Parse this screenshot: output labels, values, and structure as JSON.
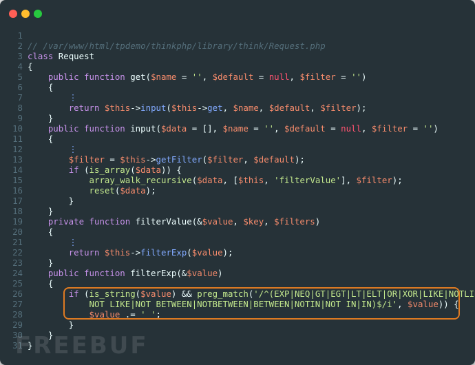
{
  "editor": {
    "file_comment": "// /var/www/html/tpdemo/thinkphp/library/think/Request.php",
    "watermark": "FREEBUF",
    "lines": [
      {
        "n": "1",
        "tokens": []
      },
      {
        "n": "2",
        "tokens": [
          {
            "c": "comment",
            "t": "// /var/www/html/tpdemo/thinkphp/library/think/Request.php"
          }
        ]
      },
      {
        "n": "3",
        "tokens": [
          {
            "c": "kw",
            "t": "class"
          },
          {
            "c": "plain",
            "t": " Request"
          }
        ]
      },
      {
        "n": "4",
        "tokens": [
          {
            "c": "plain",
            "t": "{"
          }
        ]
      },
      {
        "n": "5",
        "tokens": [
          {
            "c": "plain",
            "t": "    "
          },
          {
            "c": "kw",
            "t": "public function"
          },
          {
            "c": "plain",
            "t": " get("
          },
          {
            "c": "var",
            "t": "$name"
          },
          {
            "c": "plain",
            "t": " = "
          },
          {
            "c": "str",
            "t": "''"
          },
          {
            "c": "plain",
            "t": ", "
          },
          {
            "c": "var",
            "t": "$default"
          },
          {
            "c": "plain",
            "t": " = "
          },
          {
            "c": "null",
            "t": "null"
          },
          {
            "c": "plain",
            "t": ", "
          },
          {
            "c": "var",
            "t": "$filter"
          },
          {
            "c": "plain",
            "t": " = "
          },
          {
            "c": "str",
            "t": "''"
          },
          {
            "c": "plain",
            "t": ")"
          }
        ]
      },
      {
        "n": "6",
        "tokens": [
          {
            "c": "plain",
            "t": "    {"
          }
        ]
      },
      {
        "n": "7",
        "tokens": [
          {
            "c": "plain",
            "t": "        "
          },
          {
            "c": "dots",
            "t": "⋮"
          }
        ]
      },
      {
        "n": "8",
        "tokens": [
          {
            "c": "plain",
            "t": "        "
          },
          {
            "c": "kw",
            "t": "return"
          },
          {
            "c": "plain",
            "t": " "
          },
          {
            "c": "var",
            "t": "$this"
          },
          {
            "c": "plain",
            "t": "->"
          },
          {
            "c": "fn",
            "t": "input"
          },
          {
            "c": "plain",
            "t": "("
          },
          {
            "c": "var",
            "t": "$this"
          },
          {
            "c": "plain",
            "t": "->"
          },
          {
            "c": "fn",
            "t": "get"
          },
          {
            "c": "plain",
            "t": ", "
          },
          {
            "c": "var",
            "t": "$name"
          },
          {
            "c": "plain",
            "t": ", "
          },
          {
            "c": "var",
            "t": "$default"
          },
          {
            "c": "plain",
            "t": ", "
          },
          {
            "c": "var",
            "t": "$filter"
          },
          {
            "c": "plain",
            "t": ");"
          }
        ]
      },
      {
        "n": "9",
        "tokens": [
          {
            "c": "plain",
            "t": "    }"
          }
        ]
      },
      {
        "n": "10",
        "tokens": [
          {
            "c": "plain",
            "t": "    "
          },
          {
            "c": "kw",
            "t": "public function"
          },
          {
            "c": "plain",
            "t": " input("
          },
          {
            "c": "var",
            "t": "$data"
          },
          {
            "c": "plain",
            "t": " = [], "
          },
          {
            "c": "var",
            "t": "$name"
          },
          {
            "c": "plain",
            "t": " = "
          },
          {
            "c": "str",
            "t": "''"
          },
          {
            "c": "plain",
            "t": ", "
          },
          {
            "c": "var",
            "t": "$default"
          },
          {
            "c": "plain",
            "t": " = "
          },
          {
            "c": "null",
            "t": "null"
          },
          {
            "c": "plain",
            "t": ", "
          },
          {
            "c": "var",
            "t": "$filter"
          },
          {
            "c": "plain",
            "t": " = "
          },
          {
            "c": "str",
            "t": "''"
          },
          {
            "c": "plain",
            "t": ")"
          }
        ]
      },
      {
        "n": "11",
        "tokens": [
          {
            "c": "plain",
            "t": "    {"
          }
        ]
      },
      {
        "n": "12",
        "tokens": [
          {
            "c": "plain",
            "t": "        "
          },
          {
            "c": "dots",
            "t": "⋮"
          }
        ]
      },
      {
        "n": "13",
        "tokens": [
          {
            "c": "plain",
            "t": "        "
          },
          {
            "c": "var",
            "t": "$filter"
          },
          {
            "c": "plain",
            "t": " = "
          },
          {
            "c": "var",
            "t": "$this"
          },
          {
            "c": "plain",
            "t": "->"
          },
          {
            "c": "fn",
            "t": "getFilter"
          },
          {
            "c": "plain",
            "t": "("
          },
          {
            "c": "var",
            "t": "$filter"
          },
          {
            "c": "plain",
            "t": ", "
          },
          {
            "c": "var",
            "t": "$default"
          },
          {
            "c": "plain",
            "t": ");"
          }
        ]
      },
      {
        "n": "14",
        "tokens": [
          {
            "c": "plain",
            "t": "        "
          },
          {
            "c": "kw",
            "t": "if"
          },
          {
            "c": "plain",
            "t": " ("
          },
          {
            "c": "builtin",
            "t": "is_array"
          },
          {
            "c": "plain",
            "t": "("
          },
          {
            "c": "var",
            "t": "$data"
          },
          {
            "c": "plain",
            "t": ")) {"
          }
        ]
      },
      {
        "n": "15",
        "tokens": [
          {
            "c": "plain",
            "t": "            "
          },
          {
            "c": "builtin",
            "t": "array_walk_recursive"
          },
          {
            "c": "plain",
            "t": "("
          },
          {
            "c": "var",
            "t": "$data"
          },
          {
            "c": "plain",
            "t": ", ["
          },
          {
            "c": "var",
            "t": "$this"
          },
          {
            "c": "plain",
            "t": ", "
          },
          {
            "c": "str",
            "t": "'filterValue'"
          },
          {
            "c": "plain",
            "t": "], "
          },
          {
            "c": "var",
            "t": "$filter"
          },
          {
            "c": "plain",
            "t": ");"
          }
        ]
      },
      {
        "n": "16",
        "tokens": [
          {
            "c": "plain",
            "t": "            "
          },
          {
            "c": "builtin",
            "t": "reset"
          },
          {
            "c": "plain",
            "t": "("
          },
          {
            "c": "var",
            "t": "$data"
          },
          {
            "c": "plain",
            "t": ");"
          }
        ]
      },
      {
        "n": "17",
        "tokens": [
          {
            "c": "plain",
            "t": "        }"
          }
        ]
      },
      {
        "n": "18",
        "tokens": [
          {
            "c": "plain",
            "t": "    }"
          }
        ]
      },
      {
        "n": "19",
        "tokens": [
          {
            "c": "plain",
            "t": "    "
          },
          {
            "c": "kw",
            "t": "private function"
          },
          {
            "c": "plain",
            "t": " filterValue(&"
          },
          {
            "c": "var",
            "t": "$value"
          },
          {
            "c": "plain",
            "t": ", "
          },
          {
            "c": "var",
            "t": "$key"
          },
          {
            "c": "plain",
            "t": ", "
          },
          {
            "c": "var",
            "t": "$filters"
          },
          {
            "c": "plain",
            "t": ")"
          }
        ]
      },
      {
        "n": "20",
        "tokens": [
          {
            "c": "plain",
            "t": "    {"
          }
        ]
      },
      {
        "n": "21",
        "tokens": [
          {
            "c": "plain",
            "t": "        "
          },
          {
            "c": "dots",
            "t": "⋮"
          }
        ]
      },
      {
        "n": "22",
        "tokens": [
          {
            "c": "plain",
            "t": "        "
          },
          {
            "c": "kw",
            "t": "return"
          },
          {
            "c": "plain",
            "t": " "
          },
          {
            "c": "var",
            "t": "$this"
          },
          {
            "c": "plain",
            "t": "->"
          },
          {
            "c": "fn",
            "t": "filterExp"
          },
          {
            "c": "plain",
            "t": "("
          },
          {
            "c": "var",
            "t": "$value"
          },
          {
            "c": "plain",
            "t": ");"
          }
        ]
      },
      {
        "n": "23",
        "tokens": [
          {
            "c": "plain",
            "t": "    }"
          }
        ]
      },
      {
        "n": "24",
        "tokens": [
          {
            "c": "plain",
            "t": "    "
          },
          {
            "c": "kw",
            "t": "public function"
          },
          {
            "c": "plain",
            "t": " filterExp(&"
          },
          {
            "c": "var",
            "t": "$value"
          },
          {
            "c": "plain",
            "t": ")"
          }
        ]
      },
      {
        "n": "25",
        "tokens": [
          {
            "c": "plain",
            "t": "    {"
          }
        ]
      },
      {
        "n": "26",
        "tokens": [
          {
            "c": "plain",
            "t": "        "
          },
          {
            "c": "kw",
            "t": "if"
          },
          {
            "c": "plain",
            "t": " ("
          },
          {
            "c": "builtin",
            "t": "is_string"
          },
          {
            "c": "plain",
            "t": "("
          },
          {
            "c": "var",
            "t": "$value"
          },
          {
            "c": "plain",
            "t": ") && "
          },
          {
            "c": "builtin",
            "t": "preg_match"
          },
          {
            "c": "plain",
            "t": "("
          },
          {
            "c": "str",
            "t": "'/^(EXP|NEQ|GT|EGT|LT|ELT|OR|XOR|LIKE|NOTLIKE|"
          }
        ]
      },
      {
        "n": "27",
        "tokens": [
          {
            "c": "str",
            "t": "            NOT LIKE|NOT BETWEEN|NOTBETWEEN|BETWEEN|NOTIN|NOT IN|IN)$/i'"
          },
          {
            "c": "plain",
            "t": ", "
          },
          {
            "c": "var",
            "t": "$value"
          },
          {
            "c": "plain",
            "t": ")) {"
          }
        ]
      },
      {
        "n": "28",
        "tokens": [
          {
            "c": "plain",
            "t": "            "
          },
          {
            "c": "var",
            "t": "$value"
          },
          {
            "c": "plain",
            "t": " .= "
          },
          {
            "c": "str",
            "t": "' '"
          },
          {
            "c": "plain",
            "t": ";"
          }
        ]
      },
      {
        "n": "29",
        "tokens": [
          {
            "c": "plain",
            "t": "        }"
          }
        ]
      },
      {
        "n": "30",
        "tokens": [
          {
            "c": "plain",
            "t": "    }"
          }
        ]
      },
      {
        "n": "31",
        "tokens": [
          {
            "c": "plain",
            "t": "}"
          }
        ]
      }
    ]
  },
  "colors": {
    "background": "#263238",
    "highlight_border": "#e07b22"
  }
}
